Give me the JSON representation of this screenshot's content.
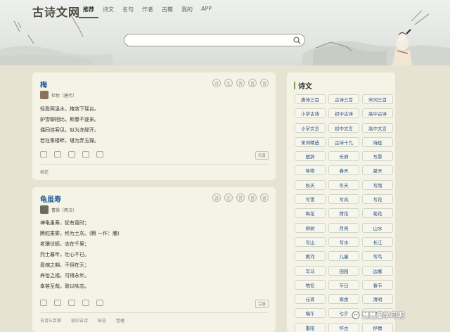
{
  "site": {
    "logo": "古诗文网"
  },
  "nav": {
    "items": [
      "推荐",
      "诗文",
      "名句",
      "作者",
      "古籍",
      "我的",
      "APP"
    ]
  },
  "search": {
    "placeholder": ""
  },
  "poems": [
    {
      "title": "梅",
      "author": "杜牧〔唐代〕",
      "tools": [
        "译",
        "注",
        "赏",
        "音",
        "背"
      ],
      "lines": [
        "轻盈照溪水，掩敛下瑶台。",
        "妒雪聊相比，欺春不逐来。",
        "偶同佳客见，似为冻醪开。",
        "若在秦楼畔，堪为弄玉媒。"
      ],
      "complete_label": "完善",
      "tags": [
        "梅花"
      ]
    },
    {
      "title": "龟虽寿",
      "author": "曹操〔两汉〕",
      "tools": [
        "译",
        "注",
        "赏",
        "音",
        "背"
      ],
      "lines": [
        "神龟虽寿，犹有竟时；",
        "腾蛇乘雾，终为土灰。(腾 一作：螣)",
        "老骥伏枥，志在千里；",
        "烈士暮年，壮心不已。",
        "盈缩之期，不但在天；",
        "养怡之福，可得永年。",
        "幸甚至哉，歌以咏志。"
      ],
      "complete_label": "完善",
      "tags": [
        "古诗三百首",
        "初中古诗",
        "咏志",
        "哲理"
      ]
    }
  ],
  "sidebar": {
    "title": "诗文",
    "items": [
      "唐诗三百",
      "古诗三百",
      "宋词三百",
      "小学古诗",
      "初中古诗",
      "高中古诗",
      "小学文言",
      "初中文言",
      "高中文言",
      "宋词精选",
      "古诗十九",
      "诗经",
      "楚辞",
      "乐府",
      "写景",
      "咏物",
      "春天",
      "夏天",
      "秋天",
      "冬天",
      "写雨",
      "写雪",
      "写风",
      "写花",
      "梅花",
      "荷花",
      "菊花",
      "柳树",
      "月亮",
      "山水",
      "写山",
      "写水",
      "长江",
      "黄河",
      "儿童",
      "写鸟",
      "写马",
      "田园",
      "边塞",
      "地名",
      "节日",
      "春节",
      "元宵",
      "寒食",
      "清明",
      "端午",
      "七夕",
      "中秋",
      "重阳",
      "怀古",
      "抒情"
    ]
  },
  "watermark": {
    "text": "慧慧爱学习呢"
  }
}
